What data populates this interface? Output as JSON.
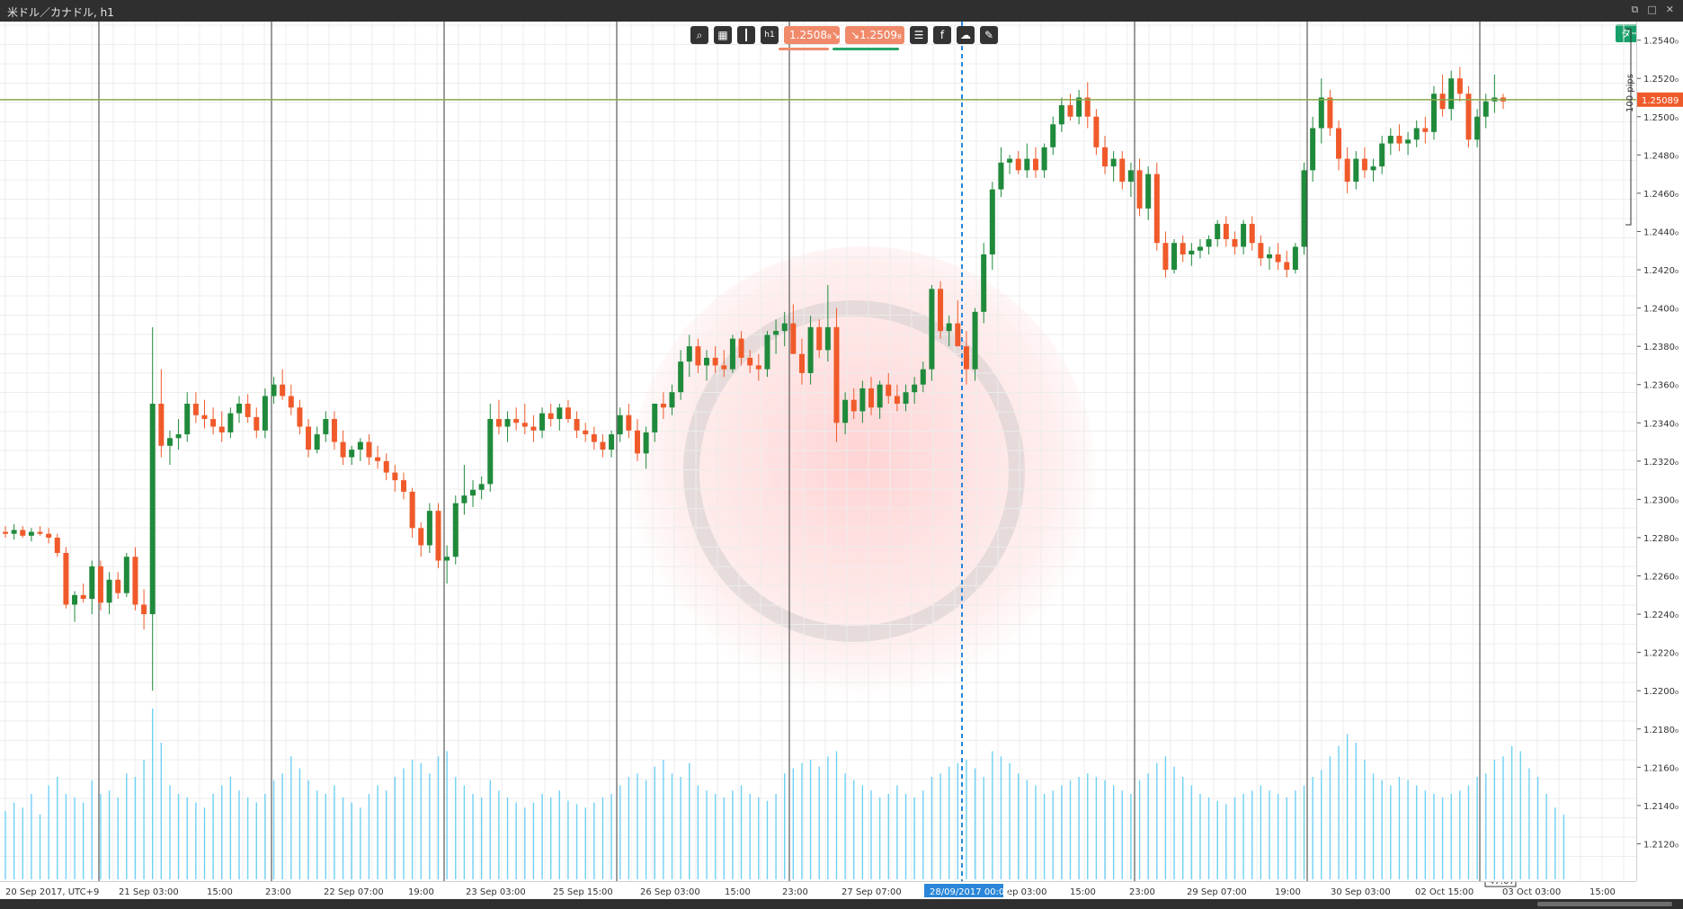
{
  "window": {
    "title": "米ドル／カナドル, h1",
    "target_label": "ターゲット"
  },
  "toolbar": {
    "sell_price": "1.2508₈",
    "buy_price": "1.2509₈",
    "tools": [
      "zoom-icon",
      "chart-type-icon",
      "candles-icon",
      "timeframe-icon",
      "list-icon",
      "fb-icon",
      "cloud-icon",
      "drawing-icon"
    ],
    "timeframe_label": "h1"
  },
  "price_axis": {
    "current_price": "1.25089",
    "pips_label": "100 pips",
    "labels": [
      "1.2540₀",
      "1.2520₀",
      "1.2500₀",
      "1.2480₀",
      "1.2460₀",
      "1.2440₀",
      "1.2420₀",
      "1.2400₀",
      "1.2380₀",
      "1.2360₀",
      "1.2340₀",
      "1.2320₀",
      "1.2300₀",
      "1.2280₀",
      "1.2260₀",
      "1.2240₀",
      "1.2220₀",
      "1.2200₀",
      "1.2180₀",
      "1.2160₀",
      "1.2140₀",
      "1.2120₀"
    ]
  },
  "time_axis": {
    "labels": [
      "20 Sep 2017, UTC+9",
      "21 Sep 03:00",
      "15:00",
      "23:00",
      "22 Sep 07:00",
      "19:00",
      "23 Sep 03:00",
      "25 Sep 15:00",
      "26 Sep 03:00",
      "15:00",
      "23:00",
      "27 Sep 07:00",
      "ep 03:00",
      "15:00",
      "23:00",
      "29 Sep 07:00",
      "19:00",
      "30 Sep 03:00",
      "02 Oct 15:00",
      "03 Oct 03:00",
      "15:00"
    ],
    "highlighted": "28/09/2017 00:00",
    "countdown": "47:07"
  },
  "colors": {
    "up": "#1f8a3b",
    "down": "#f05a2a",
    "volume": "#6fd0f5",
    "grid": "#ececec",
    "separator": "#3a3a3a",
    "current_line": "#8aa84a",
    "price_badge": "#f05a2a",
    "crosshair": "#2a86d8"
  },
  "chart_data": {
    "type": "candlestick",
    "symbol": "USD/CAD",
    "timeframe": "h1",
    "ylim": [
      1.2108,
      1.2545
    ],
    "current_price": 1.25089,
    "candles": [
      [
        1.2283,
        1.2286,
        1.228,
        1.2282
      ],
      [
        1.2282,
        1.2287,
        1.2279,
        1.2284
      ],
      [
        1.2284,
        1.2286,
        1.228,
        1.2281
      ],
      [
        1.2281,
        1.2285,
        1.2278,
        1.2283
      ],
      [
        1.2283,
        1.2286,
        1.2281,
        1.2282
      ],
      [
        1.2282,
        1.2285,
        1.2277,
        1.228
      ],
      [
        1.228,
        1.2282,
        1.227,
        1.2272
      ],
      [
        1.2272,
        1.2275,
        1.2243,
        1.2245
      ],
      [
        1.2245,
        1.2252,
        1.2236,
        1.225
      ],
      [
        1.225,
        1.2256,
        1.2246,
        1.2248
      ],
      [
        1.2248,
        1.2268,
        1.224,
        1.2265
      ],
      [
        1.2265,
        1.2268,
        1.2242,
        1.2246
      ],
      [
        1.2246,
        1.2262,
        1.224,
        1.2258
      ],
      [
        1.2258,
        1.2262,
        1.2248,
        1.2251
      ],
      [
        1.2251,
        1.2272,
        1.2249,
        1.227
      ],
      [
        1.227,
        1.2275,
        1.2242,
        1.2245
      ],
      [
        1.2245,
        1.2253,
        1.2232,
        1.224
      ],
      [
        1.224,
        1.239,
        1.22,
        1.235
      ],
      [
        1.235,
        1.2368,
        1.2322,
        1.2328
      ],
      [
        1.2328,
        1.2336,
        1.2318,
        1.2332
      ],
      [
        1.2332,
        1.2342,
        1.2326,
        1.2334
      ],
      [
        1.2334,
        1.2356,
        1.233,
        1.235
      ],
      [
        1.235,
        1.2356,
        1.234,
        1.2344
      ],
      [
        1.2344,
        1.2352,
        1.2337,
        1.2342
      ],
      [
        1.2342,
        1.2348,
        1.2334,
        1.2338
      ],
      [
        1.2338,
        1.2346,
        1.233,
        1.2335
      ],
      [
        1.2335,
        1.2348,
        1.2332,
        1.2345
      ],
      [
        1.2345,
        1.2354,
        1.234,
        1.235
      ],
      [
        1.235,
        1.2355,
        1.234,
        1.2343
      ],
      [
        1.2343,
        1.2348,
        1.2332,
        1.2336
      ],
      [
        1.2336,
        1.2358,
        1.2332,
        1.2354
      ],
      [
        1.2354,
        1.2364,
        1.235,
        1.236
      ],
      [
        1.236,
        1.2368,
        1.2352,
        1.2354
      ],
      [
        1.2354,
        1.236,
        1.2344,
        1.2348
      ],
      [
        1.2348,
        1.2352,
        1.2334,
        1.2338
      ],
      [
        1.2338,
        1.2342,
        1.2322,
        1.2326
      ],
      [
        1.2326,
        1.2338,
        1.2324,
        1.2334
      ],
      [
        1.2334,
        1.2346,
        1.233,
        1.2342
      ],
      [
        1.2342,
        1.2346,
        1.2326,
        1.233
      ],
      [
        1.233,
        1.2336,
        1.2318,
        1.2322
      ],
      [
        1.2322,
        1.2328,
        1.2318,
        1.2326
      ],
      [
        1.2326,
        1.2332,
        1.232,
        1.233
      ],
      [
        1.233,
        1.2334,
        1.2318,
        1.2322
      ],
      [
        1.2322,
        1.2328,
        1.2316,
        1.232
      ],
      [
        1.232,
        1.2324,
        1.231,
        1.2314
      ],
      [
        1.2314,
        1.2318,
        1.2304,
        1.231
      ],
      [
        1.231,
        1.2314,
        1.23,
        1.2304
      ],
      [
        1.2304,
        1.2306,
        1.228,
        1.2285
      ],
      [
        1.2285,
        1.2288,
        1.227,
        1.2276
      ],
      [
        1.2276,
        1.2298,
        1.2272,
        1.2294
      ],
      [
        1.2294,
        1.2298,
        1.2264,
        1.2268
      ],
      [
        1.2268,
        1.2276,
        1.2256,
        1.227
      ],
      [
        1.227,
        1.2302,
        1.2266,
        1.2298
      ],
      [
        1.2298,
        1.2318,
        1.2292,
        1.2302
      ],
      [
        1.2302,
        1.231,
        1.2296,
        1.2305
      ],
      [
        1.2305,
        1.2312,
        1.23,
        1.2308
      ],
      [
        1.2308,
        1.235,
        1.2304,
        1.2342
      ],
      [
        1.2342,
        1.2352,
        1.2334,
        1.2338
      ],
      [
        1.2338,
        1.2346,
        1.233,
        1.2342
      ],
      [
        1.2342,
        1.2348,
        1.2336,
        1.234
      ],
      [
        1.234,
        1.235,
        1.2334,
        1.2338
      ],
      [
        1.2338,
        1.2344,
        1.233,
        1.2336
      ],
      [
        1.2336,
        1.2348,
        1.2332,
        1.2345
      ],
      [
        1.2345,
        1.235,
        1.2338,
        1.2342
      ],
      [
        1.2342,
        1.235,
        1.2336,
        1.2348
      ],
      [
        1.2348,
        1.2352,
        1.234,
        1.2342
      ],
      [
        1.2342,
        1.2346,
        1.2332,
        1.2336
      ],
      [
        1.2336,
        1.234,
        1.233,
        1.2334
      ],
      [
        1.2334,
        1.2338,
        1.2326,
        1.233
      ],
      [
        1.233,
        1.2334,
        1.2322,
        1.2326
      ],
      [
        1.2326,
        1.2336,
        1.2322,
        1.2334
      ],
      [
        1.2334,
        1.2348,
        1.233,
        1.2344
      ],
      [
        1.2344,
        1.235,
        1.2332,
        1.2336
      ],
      [
        1.2336,
        1.2342,
        1.232,
        1.2324
      ],
      [
        1.2324,
        1.2338,
        1.2316,
        1.2335
      ],
      [
        1.2335,
        1.2346,
        1.233,
        1.235
      ],
      [
        1.235,
        1.2356,
        1.2342,
        1.2348
      ],
      [
        1.2348,
        1.236,
        1.2344,
        1.2356
      ],
      [
        1.2356,
        1.2378,
        1.2352,
        1.2372
      ],
      [
        1.2372,
        1.2386,
        1.2364,
        1.238
      ],
      [
        1.238,
        1.2384,
        1.2366,
        1.237
      ],
      [
        1.237,
        1.2378,
        1.2362,
        1.2374
      ],
      [
        1.2374,
        1.238,
        1.2366,
        1.237
      ],
      [
        1.237,
        1.2378,
        1.2364,
        1.2368
      ],
      [
        1.2368,
        1.2386,
        1.2366,
        1.2384
      ],
      [
        1.2384,
        1.2388,
        1.237,
        1.2374
      ],
      [
        1.2374,
        1.2378,
        1.2366,
        1.237
      ],
      [
        1.237,
        1.2376,
        1.2362,
        1.2368
      ],
      [
        1.2368,
        1.2388,
        1.2364,
        1.2386
      ],
      [
        1.2386,
        1.2394,
        1.2376,
        1.2388
      ],
      [
        1.2388,
        1.2398,
        1.238,
        1.2392
      ],
      [
        1.2392,
        1.2402,
        1.2384,
        1.2376
      ],
      [
        1.2376,
        1.2384,
        1.236,
        1.2366
      ],
      [
        1.2366,
        1.2396,
        1.236,
        1.239
      ],
      [
        1.239,
        1.2394,
        1.2374,
        1.2378
      ],
      [
        1.2378,
        1.2412,
        1.2372,
        1.239
      ],
      [
        1.239,
        1.24,
        1.233,
        1.234
      ],
      [
        1.234,
        1.2356,
        1.2334,
        1.2352
      ],
      [
        1.2352,
        1.2358,
        1.2342,
        1.2346
      ],
      [
        1.2346,
        1.2362,
        1.234,
        1.2358
      ],
      [
        1.2358,
        1.2364,
        1.2344,
        1.2348
      ],
      [
        1.2348,
        1.2362,
        1.2342,
        1.236
      ],
      [
        1.236,
        1.2366,
        1.235,
        1.2354
      ],
      [
        1.2354,
        1.236,
        1.2346,
        1.235
      ],
      [
        1.235,
        1.236,
        1.2346,
        1.2356
      ],
      [
        1.2356,
        1.2364,
        1.235,
        1.236
      ],
      [
        1.236,
        1.2372,
        1.2356,
        1.2368
      ],
      [
        1.2368,
        1.2412,
        1.2362,
        1.241
      ],
      [
        1.241,
        1.2414,
        1.2384,
        1.2388
      ],
      [
        1.2388,
        1.2396,
        1.238,
        1.2392
      ],
      [
        1.2392,
        1.2404,
        1.2386,
        1.238
      ],
      [
        1.238,
        1.2388,
        1.236,
        1.2368
      ],
      [
        1.2368,
        1.24,
        1.2362,
        1.2398
      ],
      [
        1.2398,
        1.2434,
        1.2392,
        1.2428
      ],
      [
        1.2428,
        1.2466,
        1.242,
        1.2462
      ],
      [
        1.2462,
        1.2484,
        1.2458,
        1.2476
      ],
      [
        1.2476,
        1.248,
        1.247,
        1.2478
      ],
      [
        1.2478,
        1.2482,
        1.247,
        1.2472
      ],
      [
        1.2472,
        1.2486,
        1.2468,
        1.2478
      ],
      [
        1.2478,
        1.2484,
        1.2468,
        1.2472
      ],
      [
        1.2472,
        1.2486,
        1.2468,
        1.2484
      ],
      [
        1.2484,
        1.25,
        1.248,
        1.2496
      ],
      [
        1.2496,
        1.251,
        1.2492,
        1.2506
      ],
      [
        1.2506,
        1.2512,
        1.2498,
        1.25
      ],
      [
        1.25,
        1.2514,
        1.2496,
        1.251
      ],
      [
        1.251,
        1.2518,
        1.2494,
        1.25
      ],
      [
        1.25,
        1.2504,
        1.248,
        1.2484
      ],
      [
        1.2484,
        1.249,
        1.247,
        1.2474
      ],
      [
        1.2474,
        1.2482,
        1.2466,
        1.2478
      ],
      [
        1.2478,
        1.2482,
        1.2462,
        1.2466
      ],
      [
        1.2466,
        1.2476,
        1.2458,
        1.2472
      ],
      [
        1.2472,
        1.2478,
        1.2448,
        1.2452
      ],
      [
        1.2452,
        1.2474,
        1.2446,
        1.247
      ],
      [
        1.247,
        1.2476,
        1.243,
        1.2434
      ],
      [
        1.2434,
        1.244,
        1.2416,
        1.242
      ],
      [
        1.242,
        1.2436,
        1.2418,
        1.2434
      ],
      [
        1.2434,
        1.2438,
        1.2424,
        1.2428
      ],
      [
        1.2428,
        1.2434,
        1.2422,
        1.243
      ],
      [
        1.243,
        1.2436,
        1.2426,
        1.2432
      ],
      [
        1.2432,
        1.2438,
        1.2428,
        1.2436
      ],
      [
        1.2436,
        1.2446,
        1.2432,
        1.2444
      ],
      [
        1.2444,
        1.2448,
        1.2432,
        1.2436
      ],
      [
        1.2436,
        1.244,
        1.2428,
        1.2432
      ],
      [
        1.2432,
        1.2446,
        1.2428,
        1.2444
      ],
      [
        1.2444,
        1.2448,
        1.243,
        1.2434
      ],
      [
        1.2434,
        1.2438,
        1.2422,
        1.2426
      ],
      [
        1.2426,
        1.2432,
        1.242,
        1.2428
      ],
      [
        1.2428,
        1.2434,
        1.242,
        1.2424
      ],
      [
        1.2424,
        1.243,
        1.2416,
        1.242
      ],
      [
        1.242,
        1.2434,
        1.2418,
        1.2432
      ],
      [
        1.2432,
        1.2476,
        1.2428,
        1.2472
      ],
      [
        1.2472,
        1.25,
        1.2466,
        1.2494
      ],
      [
        1.2494,
        1.252,
        1.2486,
        1.251
      ],
      [
        1.251,
        1.2514,
        1.249,
        1.2494
      ],
      [
        1.2494,
        1.2498,
        1.2472,
        1.2478
      ],
      [
        1.2478,
        1.2484,
        1.246,
        1.2466
      ],
      [
        1.2466,
        1.2482,
        1.2462,
        1.2478
      ],
      [
        1.2478,
        1.2484,
        1.2468,
        1.2472
      ],
      [
        1.2472,
        1.2478,
        1.2466,
        1.2474
      ],
      [
        1.2474,
        1.249,
        1.247,
        1.2486
      ],
      [
        1.2486,
        1.2494,
        1.248,
        1.249
      ],
      [
        1.249,
        1.2496,
        1.2482,
        1.2486
      ],
      [
        1.2486,
        1.2492,
        1.248,
        1.2488
      ],
      [
        1.2488,
        1.2498,
        1.2484,
        1.2494
      ],
      [
        1.2494,
        1.25,
        1.2486,
        1.2492
      ],
      [
        1.2492,
        1.2516,
        1.2488,
        1.2512
      ],
      [
        1.2512,
        1.2522,
        1.25,
        1.2504
      ],
      [
        1.2504,
        1.2524,
        1.2498,
        1.252
      ],
      [
        1.252,
        1.2526,
        1.2508,
        1.2512
      ],
      [
        1.2512,
        1.2516,
        1.2484,
        1.2488
      ],
      [
        1.2488,
        1.2504,
        1.2484,
        1.25
      ],
      [
        1.25,
        1.2512,
        1.2494,
        1.2508
      ],
      [
        1.2508,
        1.2522,
        1.2502,
        1.251
      ],
      [
        1.251,
        1.2512,
        1.2504,
        1.2508
      ]
    ],
    "volume_relative": [
      0.4,
      0.45,
      0.42,
      0.5,
      0.38,
      0.55,
      0.6,
      0.5,
      0.48,
      0.45,
      0.58,
      0.5,
      0.52,
      0.48,
      0.62,
      0.6,
      0.7,
      1.0,
      0.8,
      0.55,
      0.5,
      0.48,
      0.45,
      0.42,
      0.5,
      0.55,
      0.6,
      0.52,
      0.48,
      0.45,
      0.5,
      0.58,
      0.62,
      0.72,
      0.65,
      0.58,
      0.52,
      0.5,
      0.55,
      0.48,
      0.45,
      0.42,
      0.5,
      0.55,
      0.52,
      0.6,
      0.65,
      0.7,
      0.68,
      0.62,
      0.72,
      0.75,
      0.6,
      0.55,
      0.5,
      0.48,
      0.58,
      0.52,
      0.48,
      0.45,
      0.42,
      0.45,
      0.5,
      0.48,
      0.52,
      0.46,
      0.44,
      0.42,
      0.45,
      0.48,
      0.5,
      0.55,
      0.6,
      0.62,
      0.58,
      0.66,
      0.7,
      0.62,
      0.6,
      0.68,
      0.55,
      0.52,
      0.5,
      0.48,
      0.52,
      0.55,
      0.5,
      0.48,
      0.46,
      0.5,
      0.62,
      0.65,
      0.68,
      0.7,
      0.66,
      0.72,
      0.75,
      0.62,
      0.58,
      0.55,
      0.52,
      0.48,
      0.5,
      0.55,
      0.5,
      0.48,
      0.52,
      0.6,
      0.62,
      0.66,
      0.68,
      0.7,
      0.65,
      0.6,
      0.75,
      0.72,
      0.68,
      0.62,
      0.58,
      0.55,
      0.5,
      0.52,
      0.55,
      0.58,
      0.6,
      0.62,
      0.6,
      0.58,
      0.55,
      0.52,
      0.5,
      0.58,
      0.62,
      0.68,
      0.72,
      0.66,
      0.6,
      0.55,
      0.5,
      0.48,
      0.46,
      0.44,
      0.48,
      0.5,
      0.52,
      0.55,
      0.52,
      0.5,
      0.48,
      0.52,
      0.55,
      0.6,
      0.64,
      0.72,
      0.78,
      0.85,
      0.8,
      0.7,
      0.62,
      0.58,
      0.55,
      0.6,
      0.58,
      0.55,
      0.52,
      0.5,
      0.48,
      0.5,
      0.52,
      0.55,
      0.6,
      0.62,
      0.7,
      0.72,
      0.78,
      0.75,
      0.65,
      0.6,
      0.5,
      0.42,
      0.38
    ]
  }
}
